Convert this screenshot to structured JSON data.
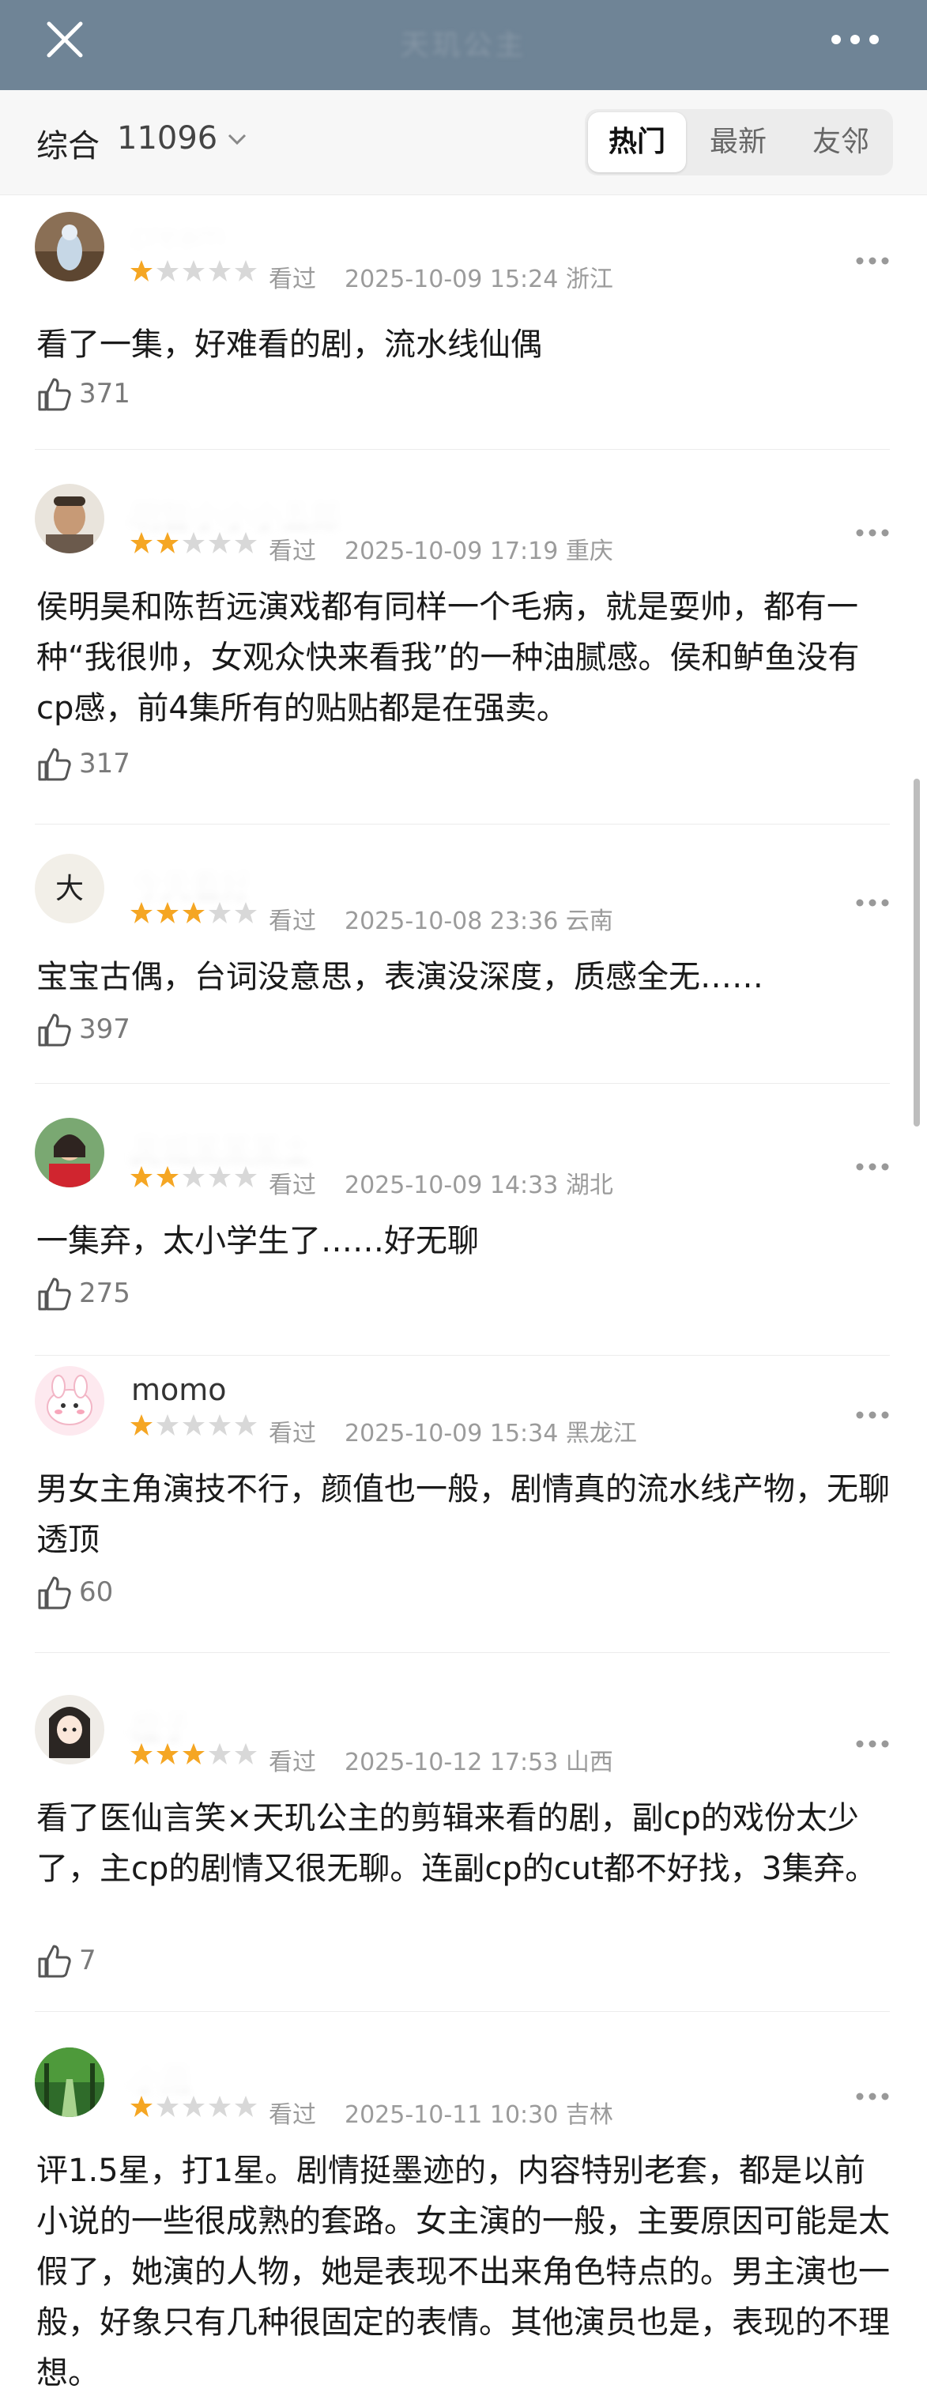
{
  "topbar": {
    "title": "天玑公主"
  },
  "filter": {
    "label": "综合",
    "count": "11096"
  },
  "tabs": [
    {
      "label": "热门",
      "active": true
    },
    {
      "label": "最新",
      "active": false
    },
    {
      "label": "友邻",
      "active": false
    }
  ],
  "reviews": [
    {
      "username": "cream",
      "username_blurred": true,
      "rating": 1,
      "status": "看过",
      "datetime": "2025-10-09 15:24",
      "location": "浙江",
      "text": "看了一集，好难看的剧，流水线仙偶",
      "likes": "371",
      "avatar": "blue-figure"
    },
    {
      "username": "明智小小小五郎",
      "username_blurred": true,
      "rating": 2,
      "status": "看过",
      "datetime": "2025-10-09 17:19",
      "location": "重庆",
      "text": "侯明昊和陈哲远演戏都有同样一个毛病，就是耍帅，都有一种“我很帅，女观众快来看我”的一种油腻感。侯和鲈鱼没有cp感，前4集所有的贴贴都是在强卖。",
      "likes": "317",
      "avatar": "man-portrait"
    },
    {
      "username": "今天看好",
      "username_blurred": true,
      "rating": 3,
      "status": "看过",
      "datetime": "2025-10-08 23:36",
      "location": "云南",
      "text": "宝宝古偶，台词没意思，表演没深度，质感全无……",
      "likes": "397",
      "avatar": "calligraphy"
    },
    {
      "username": "吴城某某某士",
      "username_blurred": true,
      "rating": 2,
      "status": "看过",
      "datetime": "2025-10-09 14:33",
      "location": "湖北",
      "text": "一集弃，太小学生了……好无聊",
      "likes": "275",
      "avatar": "girl-red"
    },
    {
      "username": "momo",
      "username_blurred": false,
      "rating": 1,
      "status": "看过",
      "datetime": "2025-10-09 15:34",
      "location": "黑龙江",
      "text": "男女主角演技不行，颜值也一般，剧情真的流水线产物，无聊透顶",
      "likes": "60",
      "avatar": "pink-bunny"
    },
    {
      "username": "橙子",
      "username_blurred": true,
      "rating": 3,
      "status": "看过",
      "datetime": "2025-10-12 17:53",
      "location": "山西",
      "text": "看了医仙言笑×天玑公主的剪辑来看的剧，副cp的戏份太少了，主cp的剧情又很无聊。连副cp的cut都不好找，3集弃。",
      "likes": "7",
      "avatar": "anime-girl"
    },
    {
      "username": "小雨",
      "username_blurred": true,
      "rating": 1,
      "status": "看过",
      "datetime": "2025-10-11 10:30",
      "location": "吉林",
      "text": "评1.5星，打1星。剧情挺墨迹的，内容特别老套，都是以前小说的一些很成熟的套路。女主演的一般，主要原因可能是太假了，她演的人物，她是表现不出来角色特点的。男主演也一般，好象只有几种很固定的表情。其他演员也是，表现的不理想。",
      "likes": "",
      "avatar": "forest"
    }
  ],
  "colors": {
    "star_filled": "#f5a623",
    "star_empty": "#d8d8d8",
    "header_bg": "#6f8496"
  }
}
